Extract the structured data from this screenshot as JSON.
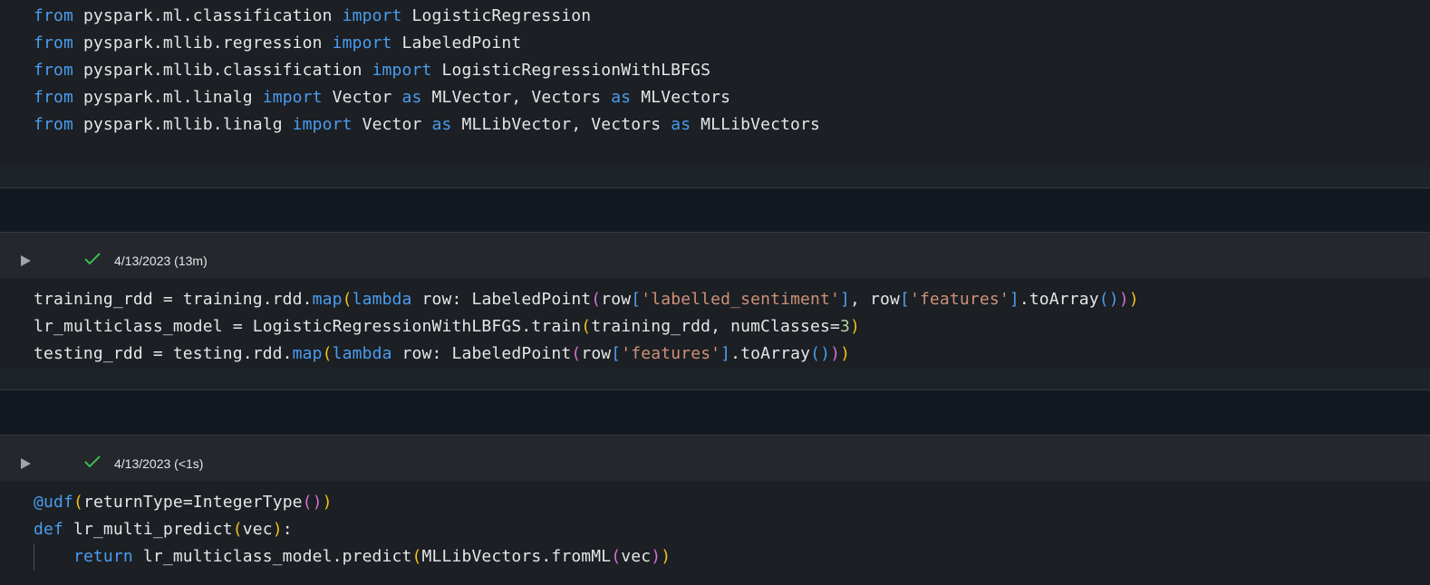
{
  "cells": [
    {
      "lines": [
        [
          [
            "kw",
            "from"
          ],
          [
            "txt",
            " pyspark.ml.classification "
          ],
          [
            "kw",
            "import"
          ],
          [
            "txt",
            " LogisticRegression"
          ]
        ],
        [
          [
            "kw",
            "from"
          ],
          [
            "txt",
            " pyspark.mllib.regression "
          ],
          [
            "kw",
            "import"
          ],
          [
            "txt",
            " LabeledPoint"
          ]
        ],
        [
          [
            "kw",
            "from"
          ],
          [
            "txt",
            " pyspark.mllib.classification "
          ],
          [
            "kw",
            "import"
          ],
          [
            "txt",
            " LogisticRegressionWithLBFGS"
          ]
        ],
        [
          [
            "kw",
            "from"
          ],
          [
            "txt",
            " pyspark.ml.linalg "
          ],
          [
            "kw",
            "import"
          ],
          [
            "txt",
            " Vector "
          ],
          [
            "kw",
            "as"
          ],
          [
            "txt",
            " MLVector, Vectors "
          ],
          [
            "kw",
            "as"
          ],
          [
            "txt",
            " MLVectors"
          ]
        ],
        [
          [
            "kw",
            "from"
          ],
          [
            "txt",
            " pyspark.mllib.linalg "
          ],
          [
            "kw",
            "import"
          ],
          [
            "txt",
            " Vector "
          ],
          [
            "kw",
            "as"
          ],
          [
            "txt",
            " MLLibVector, Vectors "
          ],
          [
            "kw",
            "as"
          ],
          [
            "txt",
            " MLLibVectors"
          ]
        ]
      ]
    },
    {
      "status": "4/13/2023 (13m)",
      "lines": [
        [
          [
            "txt",
            "training_rdd = training.rdd."
          ],
          [
            "fn",
            "map"
          ],
          [
            "brY",
            "("
          ],
          [
            "kw",
            "lambda"
          ],
          [
            "txt",
            " row: LabeledPoint"
          ],
          [
            "brP",
            "("
          ],
          [
            "txt",
            "row"
          ],
          [
            "brB",
            "["
          ],
          [
            "str",
            "'labelled_sentiment'"
          ],
          [
            "brB",
            "]"
          ],
          [
            "txt",
            ", row"
          ],
          [
            "brB",
            "["
          ],
          [
            "str",
            "'features'"
          ],
          [
            "brB",
            "]"
          ],
          [
            "txt",
            ".toArray"
          ],
          [
            "brB",
            "()"
          ],
          [
            "brP",
            ")"
          ],
          [
            "brY",
            ")"
          ]
        ],
        [
          [
            "txt",
            "lr_multiclass_model = LogisticRegressionWithLBFGS.train"
          ],
          [
            "brY",
            "("
          ],
          [
            "txt",
            "training_rdd, numClasses="
          ],
          [
            "num",
            "3"
          ],
          [
            "brY",
            ")"
          ]
        ],
        [
          [
            "txt",
            "testing_rdd = testing.rdd."
          ],
          [
            "fn",
            "map"
          ],
          [
            "brY",
            "("
          ],
          [
            "kw",
            "lambda"
          ],
          [
            "txt",
            " row: LabeledPoint"
          ],
          [
            "brP",
            "("
          ],
          [
            "txt",
            "row"
          ],
          [
            "brB",
            "["
          ],
          [
            "str",
            "'features'"
          ],
          [
            "brB",
            "]"
          ],
          [
            "txt",
            ".toArray"
          ],
          [
            "brB",
            "()"
          ],
          [
            "brP",
            ")"
          ],
          [
            "brY",
            ")"
          ]
        ]
      ]
    },
    {
      "status": "4/13/2023 (<1s)",
      "lines": [
        [
          [
            "dec",
            "@udf"
          ],
          [
            "brY",
            "("
          ],
          [
            "txt",
            "returnType=IntegerType"
          ],
          [
            "brP",
            "()"
          ],
          [
            "brY",
            ")"
          ]
        ],
        [
          [
            "kw",
            "def"
          ],
          [
            "txt",
            " lr_multi_predict"
          ],
          [
            "brY",
            "("
          ],
          [
            "txt",
            "vec"
          ],
          [
            "brY",
            ")"
          ],
          [
            "txt",
            ":"
          ]
        ],
        [
          [
            "txt",
            "    "
          ],
          [
            "kw",
            "return"
          ],
          [
            "txt",
            " lr_multiclass_model.predict"
          ],
          [
            "brY",
            "("
          ],
          [
            "txt",
            "MLLibVectors.fromML"
          ],
          [
            "brP",
            "("
          ],
          [
            "txt",
            "vec"
          ],
          [
            "brP",
            ")"
          ],
          [
            "brY",
            ")"
          ]
        ]
      ]
    }
  ],
  "icons": {
    "run": "run-cell-icon",
    "success": "check-icon"
  },
  "colors": {
    "keyword": "#4a9df0",
    "string": "#ce9178",
    "number": "#b5cea8",
    "bracket_yellow": "#f0c419",
    "bracket_purple": "#d670d6",
    "success_green": "#3fb950"
  }
}
